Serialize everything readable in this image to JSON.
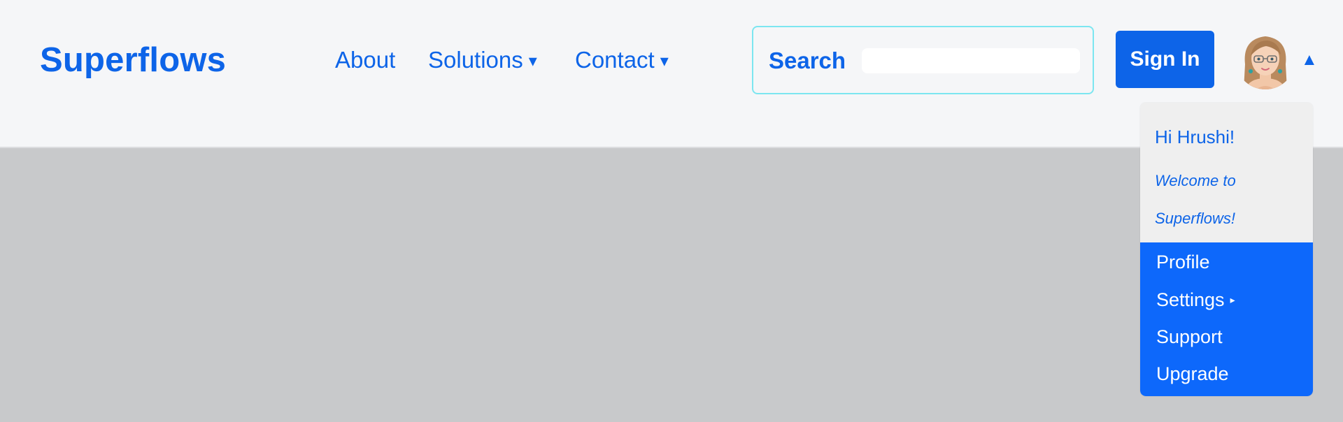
{
  "brand": {
    "name": "Superflows"
  },
  "nav": {
    "about": "About",
    "solutions": "Solutions",
    "contact": "Contact",
    "caret": "▾"
  },
  "search": {
    "label": "Search",
    "value": "",
    "placeholder": ""
  },
  "auth": {
    "sign_in_label": "Sign In"
  },
  "user_menu": {
    "caret": "▲",
    "greeting": "Hi Hrushi!",
    "welcome": "Welcome to Superflows!",
    "items": [
      {
        "label": "Profile"
      },
      {
        "label": "Settings",
        "submenu_icon": "▸"
      },
      {
        "label": "Support"
      },
      {
        "label": "Upgrade"
      }
    ]
  },
  "icons": {
    "avatar": "user-avatar-icon",
    "caret_down": "caret-down-icon",
    "caret_up": "caret-up-icon",
    "submenu": "chevron-right-icon"
  },
  "colors": {
    "brand_blue": "#0d64e8",
    "menu_blue": "#0d68fb",
    "header_bg": "#f5f6f8",
    "page_bg": "#c8c9cb",
    "search_border": "#7ce6f0",
    "dropdown_header_bg": "#efefef"
  }
}
